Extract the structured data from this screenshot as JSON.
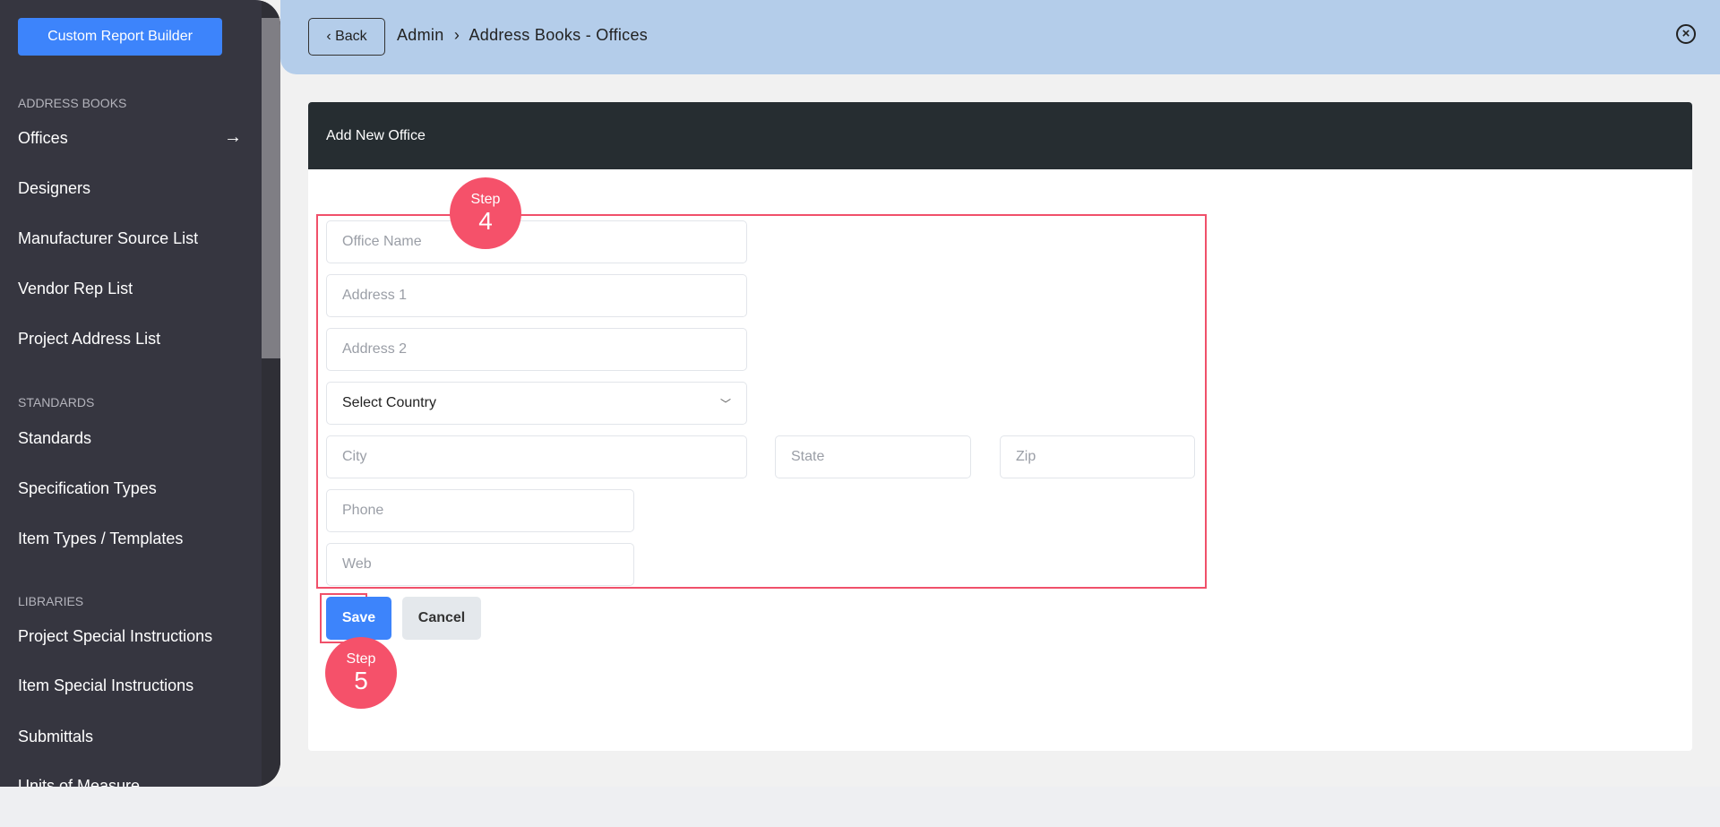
{
  "sidebar": {
    "report_button": "Custom Report Builder",
    "sections": [
      {
        "label": "ADDRESS BOOKS",
        "items": [
          "Offices",
          "Designers",
          "Manufacturer Source List",
          "Vendor Rep List",
          "Project Address List"
        ]
      },
      {
        "label": "STANDARDS",
        "items": [
          "Standards",
          "Specification Types",
          "Item Types / Templates"
        ]
      },
      {
        "label": "LIBRARIES",
        "items": [
          "Project Special Instructions",
          "Item Special Instructions",
          "Submittals",
          "Units of Measure"
        ]
      }
    ],
    "active_item": "Offices"
  },
  "header": {
    "back_label": "Back",
    "breadcrumb": [
      "Admin",
      "Address Books - Offices"
    ],
    "separator": "›"
  },
  "card": {
    "title": "Add New Office"
  },
  "form": {
    "office_name": "Office Name",
    "address1": "Address 1",
    "address2": "Address 2",
    "country": "Select Country",
    "city": "City",
    "state": "State",
    "zip": "Zip",
    "phone": "Phone",
    "web": "Web",
    "save": "Save",
    "cancel": "Cancel"
  },
  "annotations": {
    "step4": {
      "label": "Step",
      "number": "4"
    },
    "step5": {
      "label": "Step",
      "number": "5"
    },
    "color": "#f5516a"
  },
  "colors": {
    "accent": "#3d84fb",
    "header_bg": "#b4cdea",
    "sidebar_bg": "#363640"
  }
}
